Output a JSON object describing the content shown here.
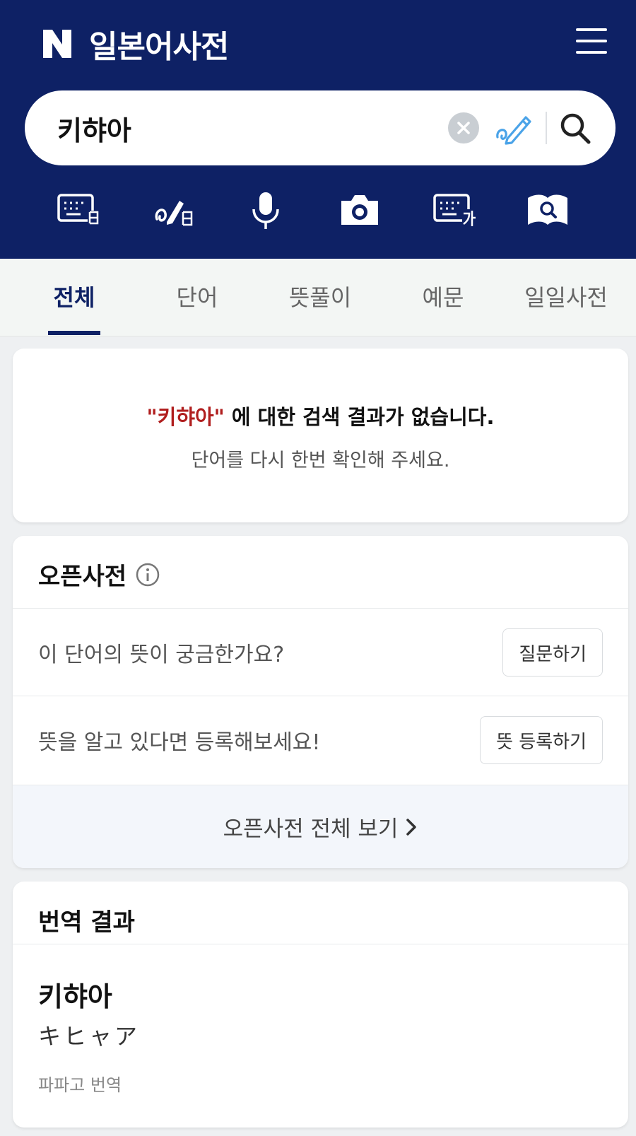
{
  "header": {
    "logo_letter": "N",
    "title": "일본어사전",
    "background": "#0e2165"
  },
  "search": {
    "value": "키햐아",
    "icons": [
      "clear-icon",
      "handwriting-icon",
      "search-icon"
    ]
  },
  "tools": [
    "keyboard-japanese-icon",
    "handwriting-japanese-icon",
    "microphone-icon",
    "camera-icon",
    "keyboard-korean-icon",
    "book-search-icon"
  ],
  "tabs": [
    {
      "label": "전체",
      "active": true
    },
    {
      "label": "단어",
      "active": false
    },
    {
      "label": "뜻풀이",
      "active": false
    },
    {
      "label": "예문",
      "active": false
    },
    {
      "label": "일일사전",
      "active": false
    }
  ],
  "no_result": {
    "query": "\"키햐아\"",
    "message": " 에 대한 검색 결과가 없습니다.",
    "hint": "단어를 다시 한번 확인해 주세요."
  },
  "open_dict": {
    "title": "오픈사전",
    "rows": [
      {
        "text": "이 단어의 뜻이 궁금한가요?",
        "button": "질문하기"
      },
      {
        "text": "뜻을 알고 있다면 등록해보세요!",
        "button": "뜻 등록하기"
      }
    ],
    "footer": "오픈사전 전체 보기"
  },
  "translation": {
    "title": "번역 결과",
    "word": "키햐아",
    "kana": "キヒャア",
    "source": "파파고 번역"
  },
  "colors": {
    "accent": "#0e2165",
    "query_red": "#b01e1e",
    "handwriting_blue": "#4aa3e8"
  }
}
